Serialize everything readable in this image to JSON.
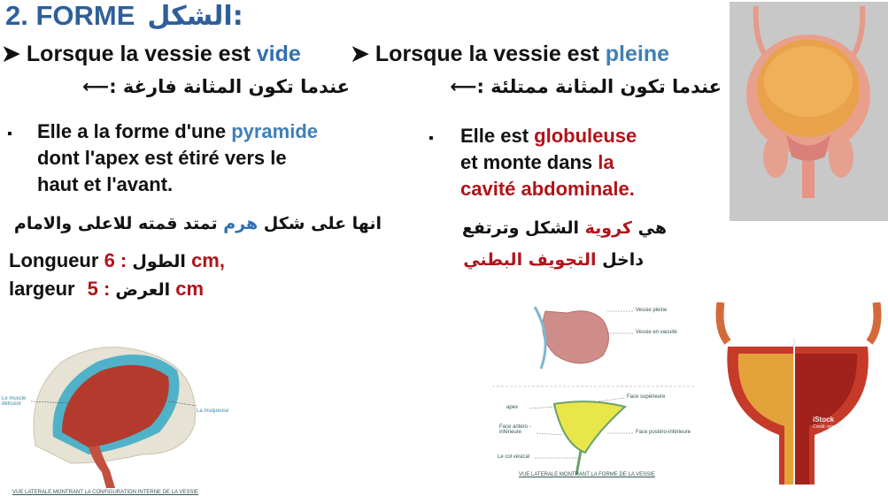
{
  "title": {
    "fr": "2. FORME",
    "ar": "الشكل:"
  },
  "left": {
    "heading_pre": "Lorsque la vessie est ",
    "heading_kw": "vide",
    "heading_ar": "عندما تكون المثانة فارغة :",
    "para_l1_pre": "Elle a la forme d'une ",
    "para_l1_kw": "pyramide",
    "para_l2": "dont l'apex est étiré vers le",
    "para_l3": "haut et l'avant.",
    "ar_pre": "انها على شكل ",
    "ar_kw": "هرم",
    "ar_post": " تمتد قمته للاعلى والامام",
    "len_label": "Longueur",
    "len_ar": "الطول",
    "len_value": ": 6  cm,",
    "wid_label": "largeur",
    "wid_ar": "العرض",
    "wid_value": ": 5 cm"
  },
  "right": {
    "heading_pre": "Lorsque la vessie est ",
    "heading_kw": "pleine",
    "heading_ar": "عندما تكون المثانة ممتلئة :",
    "para_l1_pre": "Elle est ",
    "para_l1_kw": "globuleuse",
    "para_l2_pre": "et monte dans ",
    "para_l2_kw": "la",
    "para_l3": "cavité abdominale.",
    "ar1_pre": "هي ",
    "ar1_kw": "كروية",
    "ar1_post": " الشكل وترتفع",
    "ar2_pre": "داخل ",
    "ar2_kw": "التجويف البطني"
  },
  "figure_left": {
    "label_muscle": "Le muscle détrusor",
    "label_muqueuse": "La muqueuse",
    "caption": "VUE LATERALE MONTRANT LA CONFIGURATION INTERNE DE LA VESSIE"
  },
  "figure_middle": {
    "label_pleine": "Vessie pleine",
    "label_vacuite": "Vessie en vacuité",
    "label_sup": "Face supérieure",
    "label_apex": "apex",
    "label_ant": "Face antéro -inférieure",
    "label_post": "Face postéro-inférieure",
    "label_col": "Le col vésical",
    "caption": "VUE LATERALE MONTRANT LA FORME DE LA VESSIE"
  },
  "figure_istock": {
    "watermark": "iStock",
    "credit": "Credit: ericsnow"
  },
  "colors": {
    "title": "#2e5f9a",
    "keyword_blue": "#2f6fb3",
    "keyword_red": "#b0141a"
  }
}
